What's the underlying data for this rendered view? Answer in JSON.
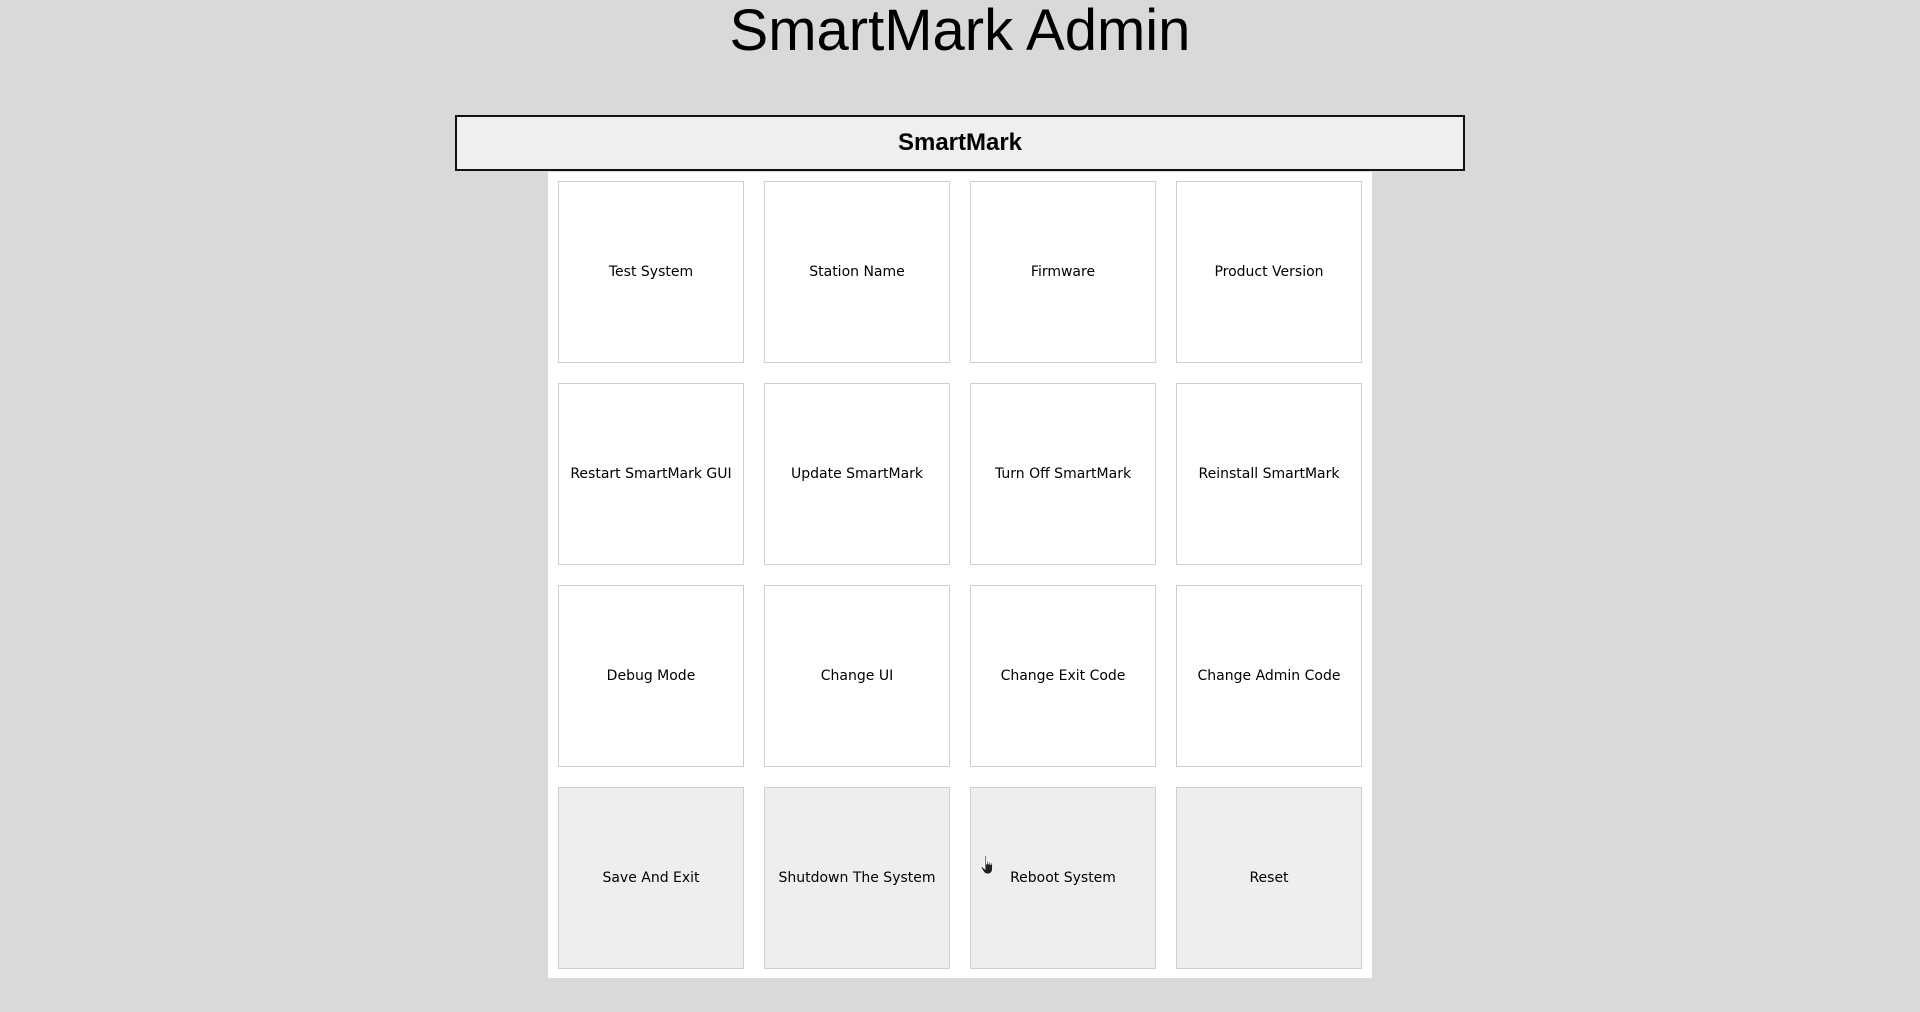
{
  "app": {
    "title": "SmartMark Admin",
    "header": "SmartMark"
  },
  "tiles": [
    {
      "label": "Test System",
      "name": "test-system-button",
      "alt": false
    },
    {
      "label": "Station Name",
      "name": "station-name-button",
      "alt": false
    },
    {
      "label": "Firmware",
      "name": "firmware-button",
      "alt": false
    },
    {
      "label": "Product Version",
      "name": "product-version-button",
      "alt": false
    },
    {
      "label": "Restart SmartMark GUI",
      "name": "restart-gui-button",
      "alt": false
    },
    {
      "label": "Update SmartMark",
      "name": "update-smartmark-button",
      "alt": false
    },
    {
      "label": "Turn Off SmartMark",
      "name": "turn-off-smartmark-button",
      "alt": false
    },
    {
      "label": "Reinstall SmartMark",
      "name": "reinstall-smartmark-button",
      "alt": false
    },
    {
      "label": "Debug Mode",
      "name": "debug-mode-button",
      "alt": false
    },
    {
      "label": "Change UI",
      "name": "change-ui-button",
      "alt": false
    },
    {
      "label": "Change Exit Code",
      "name": "change-exit-code-button",
      "alt": false
    },
    {
      "label": "Change Admin Code",
      "name": "change-admin-code-button",
      "alt": false
    },
    {
      "label": "Save And Exit",
      "name": "save-and-exit-button",
      "alt": true
    },
    {
      "label": "Shutdown The System",
      "name": "shutdown-system-button",
      "alt": true
    },
    {
      "label": "Reboot System",
      "name": "reboot-system-button",
      "alt": true
    },
    {
      "label": "Reset",
      "name": "reset-button",
      "alt": true
    }
  ],
  "colors": {
    "background": "#d9d9d9",
    "panel": "#ffffff",
    "header_bg": "#efefef",
    "tile_alt": "#eeeeee"
  }
}
